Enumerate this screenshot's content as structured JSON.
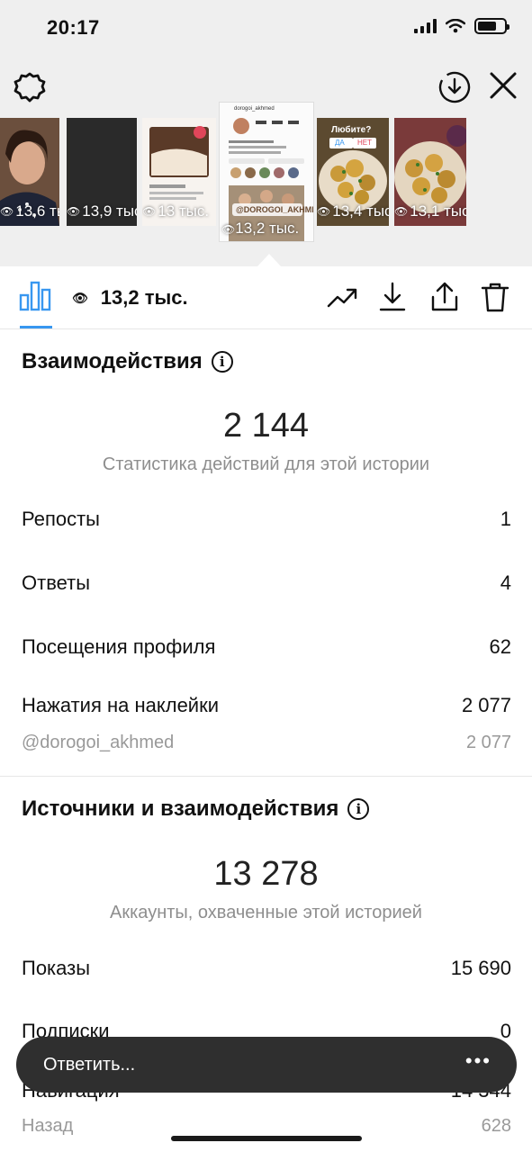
{
  "status": {
    "time": "20:17"
  },
  "thumbnails": [
    {
      "views": "13,6 тыс."
    },
    {
      "views": "13,9 тыс."
    },
    {
      "views": "13 тыс."
    },
    {
      "views": "13,2 тыс.",
      "selected": true
    },
    {
      "views": "13,4 тыс."
    },
    {
      "views": "13,1 тыс."
    }
  ],
  "selected_story": {
    "username": "dorogoi_akhmed",
    "stats": [
      "888",
      "272 тыс",
      "40"
    ],
    "sticker_text": "@DOROGOI_AKHMED"
  },
  "poll_sticker": {
    "question": "Любите?",
    "yes": "ДА",
    "no": "НЕТ"
  },
  "toolbar": {
    "views": "13,2 тыс."
  },
  "interactions": {
    "title": "Взаимодействия",
    "total": "2 144",
    "subtitle": "Статистика действий для этой истории",
    "rows": [
      {
        "label": "Репосты",
        "value": "1"
      },
      {
        "label": "Ответы",
        "value": "4"
      },
      {
        "label": "Посещения профиля",
        "value": "62"
      },
      {
        "label": "Нажатия на наклейки",
        "value": "2 077"
      }
    ],
    "sub_row": {
      "label": "@dorogoi_akhmed",
      "value": "2 077"
    }
  },
  "discovery": {
    "title": "Источники и взаимодействия",
    "total": "13 278",
    "subtitle": "Аккаунты, охваченные этой историей",
    "rows": [
      {
        "label": "Показы",
        "value": "15 690"
      },
      {
        "label": "Подписки",
        "value": "0"
      },
      {
        "label": "Навигация",
        "value": "14 344"
      }
    ],
    "sub_row": {
      "label": "Назад",
      "value": "628"
    }
  },
  "reply": {
    "placeholder": "Ответить...",
    "more": "•••"
  },
  "colors": {
    "accent": "#3897f0",
    "background_top": "#efefef",
    "reply_bar": "#2f2f2f"
  },
  "icons": [
    "settings-gear-icon",
    "download-circle-icon",
    "close-icon",
    "bar-chart-icon",
    "eye-icon",
    "trend-icon",
    "download-icon",
    "share-icon",
    "trash-icon",
    "info-icon"
  ]
}
